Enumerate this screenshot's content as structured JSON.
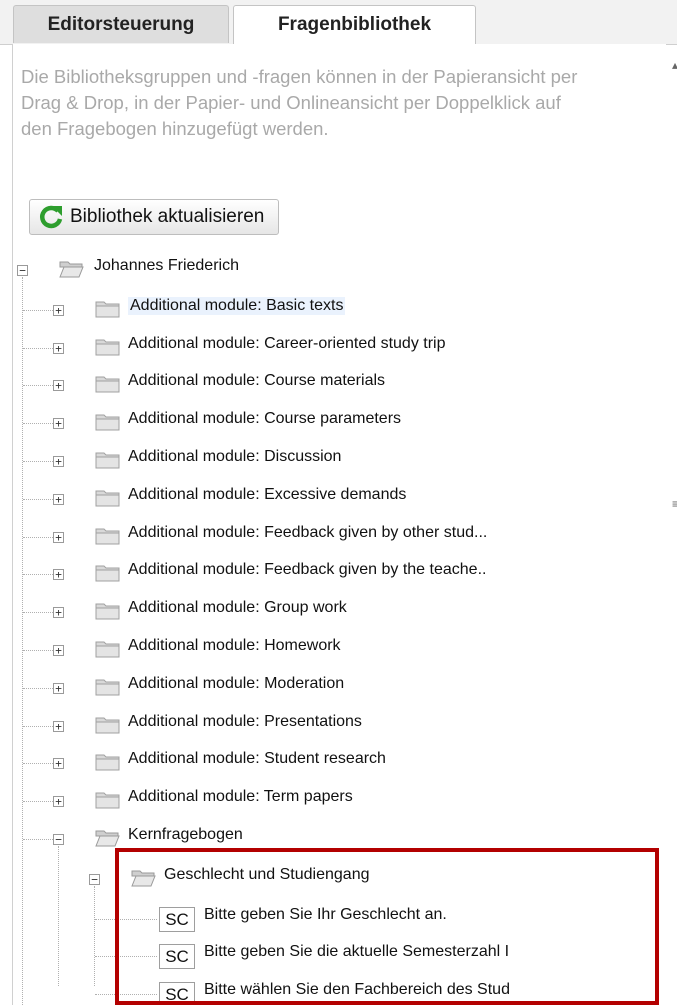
{
  "tabs": [
    {
      "label": "Editorsteuerung",
      "active": false
    },
    {
      "label": "Fragenbibliothek",
      "active": true
    }
  ],
  "hint": "Die Bibliotheksgruppen und -fragen können in der Papieransicht per Drag & Drop, in der Papier- und Onlineansicht per Doppelklick auf den Fragebogen hinzugefügt werden.",
  "refresh_button": {
    "label": "Bibliothek aktualisieren",
    "icon": "refresh-icon"
  },
  "tree": {
    "root": {
      "label": "Johannes Friederich",
      "expanded": true
    },
    "modules": [
      "Additional module: Basic texts",
      "Additional module: Career-oriented study trip",
      "Additional module: Course materials",
      "Additional module: Course parameters",
      "Additional module: Discussion",
      "Additional module: Excessive demands",
      "Additional module: Feedback given by other stud...",
      "Additional module: Feedback given by the teache..",
      "Additional module: Group work",
      "Additional module: Homework",
      "Additional module: Moderation",
      "Additional module: Presentations",
      "Additional module: Student research",
      "Additional module: Term papers"
    ],
    "selected_index": 0,
    "core": {
      "label": "Kernfragebogen",
      "expanded": true
    },
    "group": {
      "label": "Geschlecht und Studiengang",
      "expanded": true
    },
    "questions": [
      {
        "type": "SC",
        "label": "Bitte geben Sie Ihr Geschlecht an."
      },
      {
        "type": "SC",
        "label": "Bitte geben Sie die aktuelle Semesterzahl I"
      },
      {
        "type": "SC",
        "label": "Bitte wählen Sie den Fachbereich des Stud"
      }
    ]
  },
  "colors": {
    "highlight_border": "#b30000",
    "refresh_icon": "#2e9e2e",
    "selection": "#eaf2fd"
  }
}
